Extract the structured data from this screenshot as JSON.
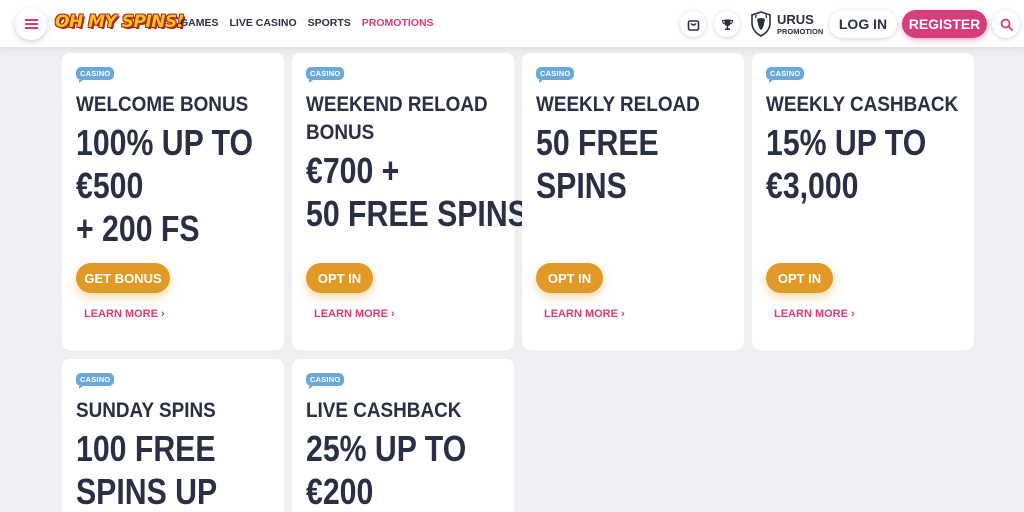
{
  "header": {
    "logo": "OH MY SPINS!",
    "nav": [
      "GAMES",
      "LIVE CASINO",
      "SPORTS",
      "PROMOTIONS"
    ],
    "active_nav": "PROMOTIONS",
    "promo_title": "URUS",
    "promo_sub": "PROMOTION",
    "login_label": "LOG IN",
    "register_label": "REGISTER",
    "icons": [
      "menu-icon",
      "bag-icon",
      "trophy-icon",
      "bull-icon",
      "search-icon"
    ]
  },
  "colors": {
    "accent": "#d63d7a",
    "cta": "#e19a27",
    "badge": "#6aa9d8",
    "text": "#2a2f45",
    "background": "#eeeff3"
  },
  "cards": [
    {
      "badge": "CASINO",
      "title": [
        "WELCOME BONUS"
      ],
      "offer": [
        "100% UP TO",
        "€500",
        "+ 200 FS"
      ],
      "cta": "GET BONUS",
      "learn": "LEARN MORE"
    },
    {
      "badge": "CASINO",
      "title": [
        "WEEKEND RELOAD",
        "BONUS"
      ],
      "offer": [
        "€700 +",
        "50 FREE SPINS"
      ],
      "cta": "OPT IN",
      "learn": "LEARN MORE"
    },
    {
      "badge": "CASINO",
      "title": [
        "WEEKLY RELOAD"
      ],
      "offer": [
        "50 FREE",
        "SPINS"
      ],
      "cta": "OPT IN",
      "learn": "LEARN MORE"
    },
    {
      "badge": "CASINO",
      "title": [
        "WEEKLY CASHBACK"
      ],
      "offer": [
        "15% UP TO",
        "€3,000"
      ],
      "cta": "OPT IN",
      "learn": "LEARN MORE"
    },
    {
      "badge": "CASINO",
      "title": [
        "SUNDAY SPINS"
      ],
      "offer": [
        "100 FREE",
        "SPINS UP"
      ]
    },
    {
      "badge": "CASINO",
      "title": [
        "LIVE CASHBACK"
      ],
      "offer": [
        "25% UP TO",
        "€200"
      ]
    }
  ]
}
